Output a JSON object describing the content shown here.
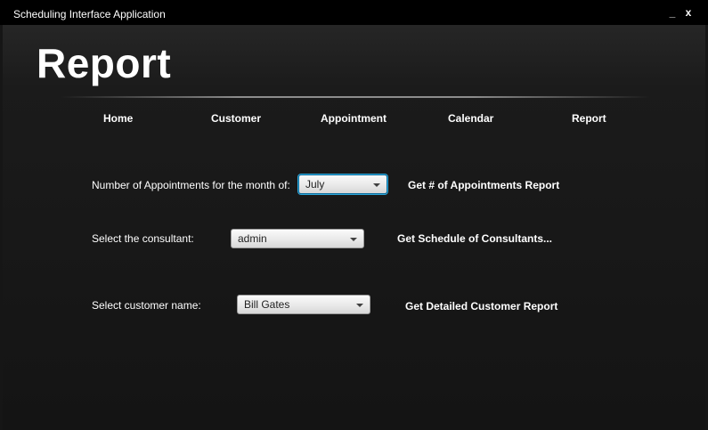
{
  "window": {
    "title": "Scheduling Interface Application",
    "minimize_glyph": "_",
    "close_glyph": "x"
  },
  "page": {
    "title": "Report"
  },
  "nav": {
    "items": [
      {
        "label": "Home"
      },
      {
        "label": "Customer"
      },
      {
        "label": "Appointment"
      },
      {
        "label": "Calendar"
      },
      {
        "label": "Report"
      }
    ]
  },
  "reports": {
    "appointments": {
      "label": "Number of Appointments for the month of:",
      "selected": "July",
      "action": "Get # of  Appointments Report"
    },
    "consultant": {
      "label": "Select the consultant:",
      "selected": "admin",
      "action": "Get Schedule of Consultants..."
    },
    "customer": {
      "label": "Select customer name:",
      "selected": "Bill Gates",
      "action": "Get Detailed Customer Report"
    }
  },
  "colors": {
    "background": "#161616",
    "titlebar": "#000000",
    "text": "#ffffff",
    "focus_ring": "#2fa6d8"
  },
  "icons": {
    "minimize": "minimize-icon",
    "close": "close-icon",
    "dropdown": "chevron-down-icon"
  }
}
